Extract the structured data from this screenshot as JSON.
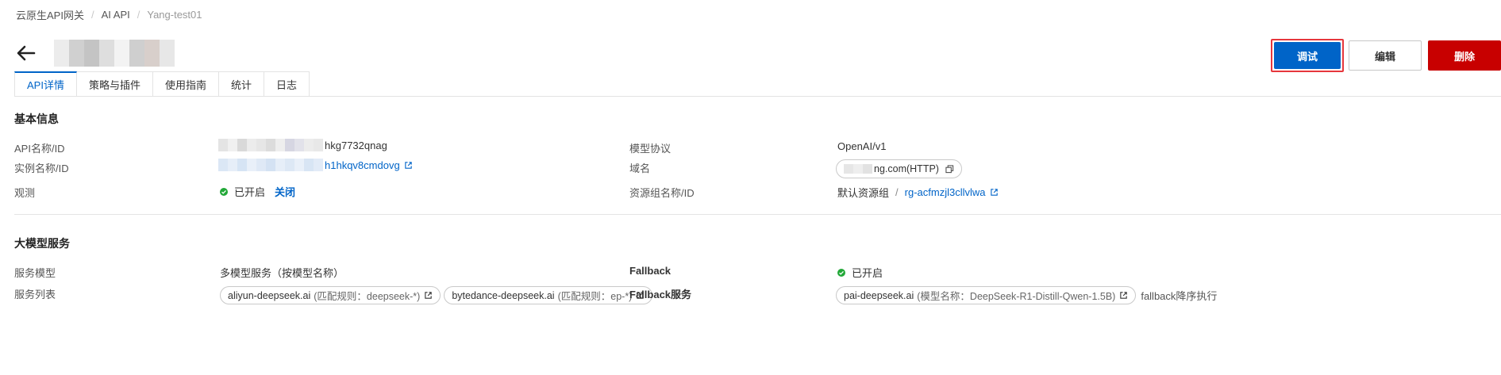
{
  "breadcrumb": {
    "item1": "云原生API网关",
    "item2": "AI API",
    "current": "Yang-test01",
    "sep": "/"
  },
  "actions": {
    "debug": "调试",
    "edit": "编辑",
    "delete": "删除"
  },
  "tabs": [
    "API详情",
    "策略与插件",
    "使用指南",
    "统计",
    "日志"
  ],
  "basic": {
    "title": "基本信息",
    "api_name_label": "API名称/ID",
    "api_name_value": "hkg7732qnag",
    "instance_label": "实例名称/ID",
    "instance_value": "h1hkqv8cmdovg",
    "observe_label": "观测",
    "observe_status": "已开启",
    "observe_action": "关闭",
    "protocol_label": "模型协议",
    "protocol_value": "OpenAI/v1",
    "domain_label": "域名",
    "domain_value": "ng.com(HTTP)",
    "resource_label": "资源组名称/ID",
    "resource_name": "默认资源组",
    "resource_sep": "/",
    "resource_id": "rg-acfmzjl3cllvlwa"
  },
  "model": {
    "title": "大模型服务",
    "service_model_label": "服务模型",
    "service_model_value": "多模型服务（按模型名称）",
    "service_list_label": "服务列表",
    "services": [
      {
        "name": "aliyun-deepseek.ai",
        "rule": "(匹配规则：deepseek-*)"
      },
      {
        "name": "bytedance-deepseek.ai",
        "rule": "(匹配规则：ep-*)"
      }
    ],
    "fallback_label": "Fallback",
    "fallback_status": "已开启",
    "fallback_service_label": "Fallback服务",
    "fallback_service_name": "pai-deepseek.ai",
    "fallback_service_rule": "(模型名称：DeepSeek-R1-Distill-Qwen-1.5B)",
    "fallback_order": "fallback降序执行"
  },
  "colors": {
    "primary": "#0064c8",
    "danger": "#c80000",
    "success": "#22a838",
    "highlight": "#e6373c"
  },
  "icons": [
    "back-arrow-icon",
    "external-link-icon",
    "copy-icon",
    "check-circle-icon"
  ]
}
